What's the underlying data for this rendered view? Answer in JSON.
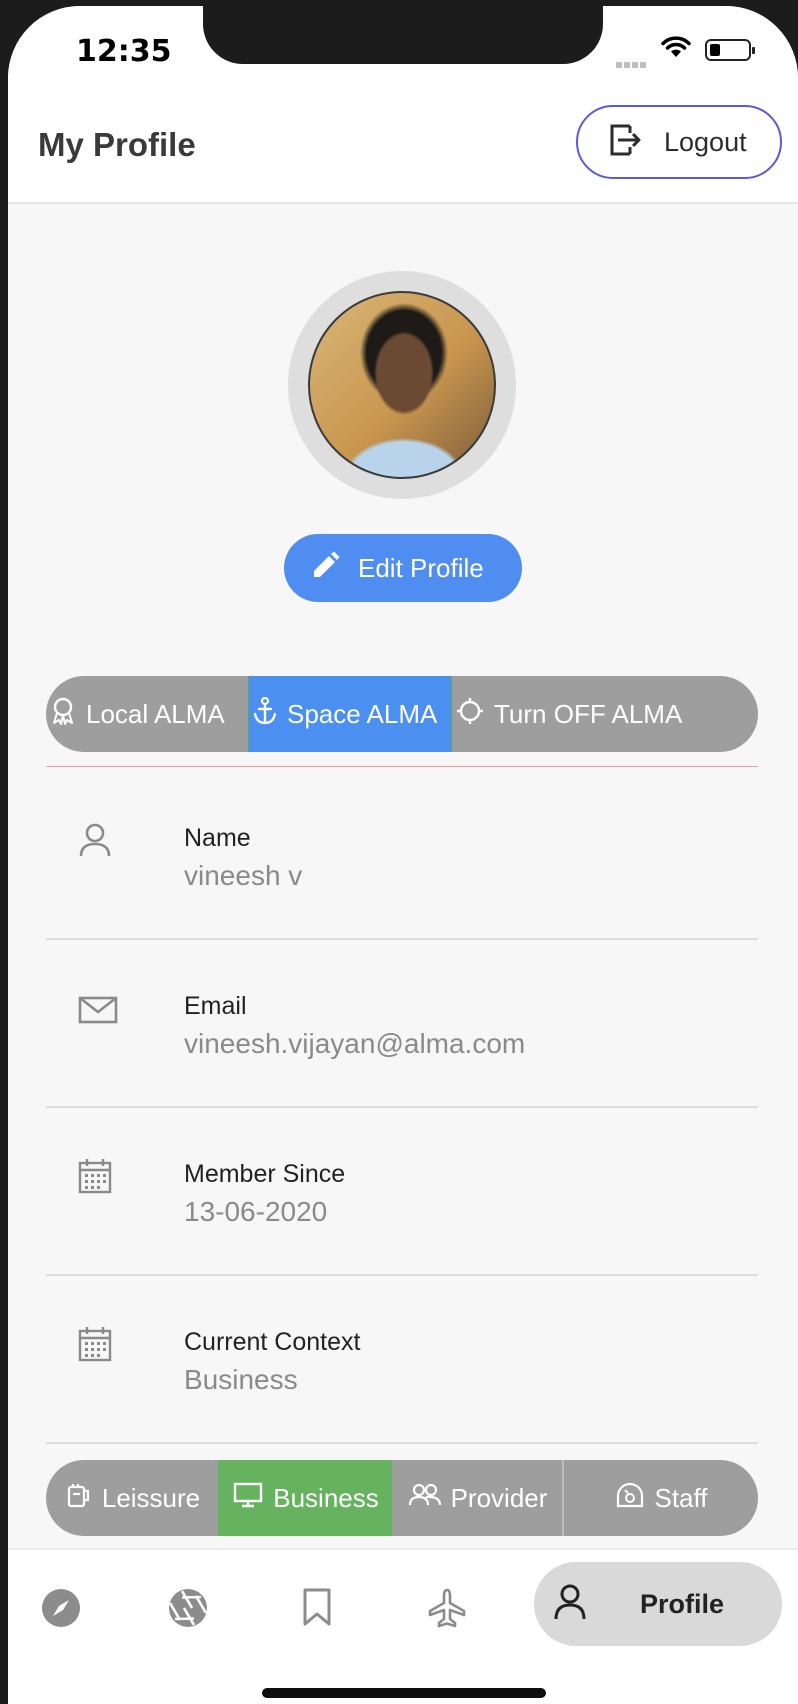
{
  "status_bar": {
    "time": "12:35"
  },
  "header": {
    "title": "My Profile",
    "logout_label": "Logout"
  },
  "profile": {
    "edit_label": "Edit Profile"
  },
  "alma_modes": {
    "options": [
      "Local ALMA",
      "Space ALMA",
      "Turn OFF ALMA"
    ],
    "selected": "Space ALMA",
    "selected_color": "#4b8ff0"
  },
  "fields": [
    {
      "label": "Name",
      "value": "vineesh v",
      "icon": "person-icon"
    },
    {
      "label": "Email",
      "value": "vineesh.vijayan@alma.com",
      "icon": "mail-icon"
    },
    {
      "label": "Member Since",
      "value": "13-06-2020",
      "icon": "calendar-icon"
    },
    {
      "label": "Current Context",
      "value": "Business",
      "icon": "calendar-icon"
    }
  ],
  "contexts": {
    "options": [
      "Leissure",
      "Business",
      "Provider",
      "Staff"
    ],
    "selected": "Business",
    "selected_color": "#66b35f"
  },
  "bottom_nav": {
    "items": [
      "compass-icon",
      "aperture-icon",
      "bookmark-icon",
      "airplane-icon",
      "person-icon"
    ],
    "active_label": "Profile"
  },
  "colors": {
    "accent_blue": "#4f8df0",
    "logout_border": "#5b5bd6",
    "segment_gray": "#9e9e9e"
  }
}
